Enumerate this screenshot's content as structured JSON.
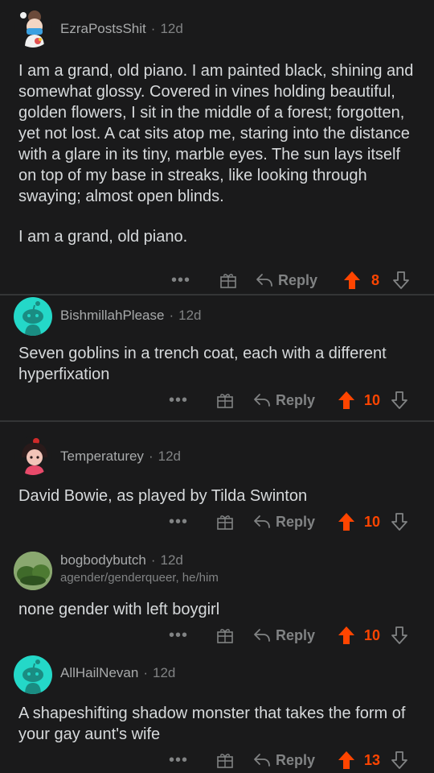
{
  "comments": [
    {
      "username": "EzraPostsShit",
      "age": "12d",
      "paragraphs": [
        "I am a grand, old piano. I am painted black, shining and somewhat glossy. Covered in vines holding beautiful, golden flowers, I sit in the middle of a forest; forgotten, yet not lost. A cat sits atop me, staring into the distance with a glare in its tiny, marble eyes. The sun lays itself on top of my base in streaks, like looking through swaying; almost open blinds.",
        "I am a grand, old piano."
      ],
      "reply_label": "Reply",
      "score": "8"
    },
    {
      "username": "BishmillahPlease",
      "age": "12d",
      "paragraphs": [
        "Seven goblins in a trench coat, each with a different hyperfixation"
      ],
      "reply_label": "Reply",
      "score": "10"
    },
    {
      "username": "Temperaturey",
      "age": "12d",
      "paragraphs": [
        "David Bowie, as played by Tilda Swinton"
      ],
      "reply_label": "Reply",
      "score": "10"
    },
    {
      "username": "bogbodybutch",
      "age": "12d",
      "flair": "agender/genderqueer, he/him",
      "paragraphs": [
        "none gender with left boygirl"
      ],
      "reply_label": "Reply",
      "score": "10"
    },
    {
      "username": "AllHailNevan",
      "age": "12d",
      "paragraphs": [
        "A shapeshifting shadow monster that takes the form of your gay aunt's wife"
      ],
      "reply_label": "Reply",
      "score": "13"
    }
  ],
  "more_label": "•••",
  "colors": {
    "upvote": "#ff4500",
    "background": "#1a1a1b",
    "snoo_bg": "#24d8c8"
  }
}
